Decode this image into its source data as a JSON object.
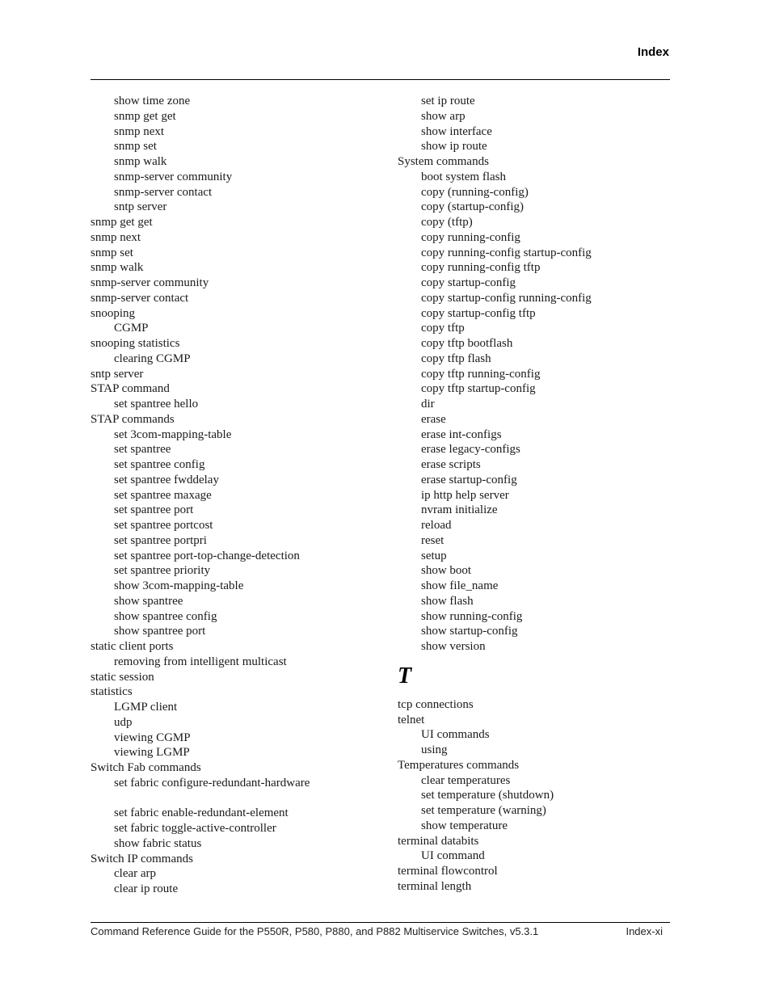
{
  "header": {
    "title": "Index"
  },
  "left_column": [
    {
      "text": "show time zone",
      "level": 1
    },
    {
      "text": "snmp get get",
      "level": 1
    },
    {
      "text": "snmp next",
      "level": 1
    },
    {
      "text": "snmp set",
      "level": 1
    },
    {
      "text": "snmp walk",
      "level": 1
    },
    {
      "text": "snmp-server community",
      "level": 1
    },
    {
      "text": "snmp-server contact",
      "level": 1
    },
    {
      "text": "sntp server",
      "level": 1
    },
    {
      "text": "snmp get get",
      "level": 0
    },
    {
      "text": "snmp next",
      "level": 0
    },
    {
      "text": "snmp set",
      "level": 0
    },
    {
      "text": "snmp walk",
      "level": 0
    },
    {
      "text": "snmp-server community",
      "level": 0
    },
    {
      "text": "snmp-server contact",
      "level": 0
    },
    {
      "text": "snooping",
      "level": 0
    },
    {
      "text": "CGMP",
      "level": 1
    },
    {
      "text": "snooping statistics",
      "level": 0
    },
    {
      "text": "clearing CGMP",
      "level": 1
    },
    {
      "text": "sntp server",
      "level": 0
    },
    {
      "text": "STAP command",
      "level": 0
    },
    {
      "text": "set spantree hello",
      "level": 1
    },
    {
      "text": "STAP commands",
      "level": 0
    },
    {
      "text": "set 3com-mapping-table",
      "level": 1
    },
    {
      "text": "set spantree",
      "level": 1
    },
    {
      "text": "set spantree config",
      "level": 1
    },
    {
      "text": "set spantree fwddelay",
      "level": 1
    },
    {
      "text": "set spantree maxage",
      "level": 1
    },
    {
      "text": "set spantree port",
      "level": 1
    },
    {
      "text": "set spantree portcost",
      "level": 1
    },
    {
      "text": "set spantree portpri",
      "level": 1
    },
    {
      "text": "set spantree port-top-change-detection",
      "level": 1
    },
    {
      "text": "set spantree priority",
      "level": 1
    },
    {
      "text": "show 3com-mapping-table",
      "level": 1
    },
    {
      "text": "show spantree",
      "level": 1
    },
    {
      "text": "show spantree config",
      "level": 1
    },
    {
      "text": "show spantree port",
      "level": 1
    },
    {
      "text": "static client ports",
      "level": 0
    },
    {
      "text": "removing from intelligent multicast",
      "level": 1
    },
    {
      "text": "static session",
      "level": 0
    },
    {
      "text": "statistics",
      "level": 0
    },
    {
      "text": "LGMP client",
      "level": 1
    },
    {
      "text": "udp",
      "level": 1
    },
    {
      "text": "viewing CGMP",
      "level": 1
    },
    {
      "text": "viewing LGMP",
      "level": 1
    },
    {
      "text": "Switch Fab commands",
      "level": 0
    },
    {
      "text": "set fabric configure-redundant-hardware",
      "level": 1
    },
    {
      "text": "",
      "level": -1
    },
    {
      "text": "set fabric enable-redundant-element",
      "level": 1
    },
    {
      "text": "set fabric toggle-active-controller",
      "level": 1
    },
    {
      "text": "show fabric status",
      "level": 1
    },
    {
      "text": "Switch IP commands",
      "level": 0
    },
    {
      "text": "clear arp",
      "level": 1
    },
    {
      "text": "clear ip route",
      "level": 1
    }
  ],
  "right_column_top": [
    {
      "text": "set ip route",
      "level": 1
    },
    {
      "text": "show arp",
      "level": 1
    },
    {
      "text": "show interface",
      "level": 1
    },
    {
      "text": "show ip route",
      "level": 1
    },
    {
      "text": "System commands",
      "level": 0
    },
    {
      "text": "boot system flash",
      "level": 1
    },
    {
      "text": "copy (running-config)",
      "level": 1
    },
    {
      "text": "copy (startup-config)",
      "level": 1
    },
    {
      "text": "copy (tftp)",
      "level": 1
    },
    {
      "text": "copy running-config",
      "level": 1
    },
    {
      "text": "copy running-config startup-config",
      "level": 1
    },
    {
      "text": "copy running-config tftp",
      "level": 1
    },
    {
      "text": "copy startup-config",
      "level": 1
    },
    {
      "text": "copy startup-config running-config",
      "level": 1
    },
    {
      "text": "copy startup-config tftp",
      "level": 1
    },
    {
      "text": "copy tftp",
      "level": 1
    },
    {
      "text": "copy tftp bootflash",
      "level": 1
    },
    {
      "text": "copy tftp flash",
      "level": 1
    },
    {
      "text": "copy tftp running-config",
      "level": 1
    },
    {
      "text": "copy tftp startup-config",
      "level": 1
    },
    {
      "text": "dir",
      "level": 1
    },
    {
      "text": "erase",
      "level": 1
    },
    {
      "text": "erase int-configs",
      "level": 1
    },
    {
      "text": "erase legacy-configs",
      "level": 1
    },
    {
      "text": "erase scripts",
      "level": 1
    },
    {
      "text": "erase startup-config",
      "level": 1
    },
    {
      "text": "ip http help server",
      "level": 1
    },
    {
      "text": "nvram initialize",
      "level": 1
    },
    {
      "text": "reload",
      "level": 1
    },
    {
      "text": "reset",
      "level": 1
    },
    {
      "text": "setup",
      "level": 1
    },
    {
      "text": "show boot",
      "level": 1
    },
    {
      "text": "show file_name",
      "level": 1
    },
    {
      "text": "show flash",
      "level": 1
    },
    {
      "text": "show running-config",
      "level": 1
    },
    {
      "text": "show startup-config",
      "level": 1
    },
    {
      "text": "show version",
      "level": 1
    }
  ],
  "section_letter": "T",
  "right_column_bottom": [
    {
      "text": "tcp connections",
      "level": 0
    },
    {
      "text": "telnet",
      "level": 0
    },
    {
      "text": "UI commands",
      "level": 1
    },
    {
      "text": "using",
      "level": 1
    },
    {
      "text": "Temperatures commands",
      "level": 0
    },
    {
      "text": "clear temperatures",
      "level": 1
    },
    {
      "text": "set temperature (shutdown)",
      "level": 1
    },
    {
      "text": "set temperature (warning)",
      "level": 1
    },
    {
      "text": "show temperature",
      "level": 1
    },
    {
      "text": "terminal databits",
      "level": 0
    },
    {
      "text": "UI command",
      "level": 1
    },
    {
      "text": "terminal flowcontrol",
      "level": 0
    },
    {
      "text": "terminal length",
      "level": 0
    }
  ],
  "footer": {
    "document_title": "Command Reference Guide for the P550R, P580, P880, and P882 Multiservice Switches, v5.3.1",
    "page_number": "Index-xi"
  }
}
